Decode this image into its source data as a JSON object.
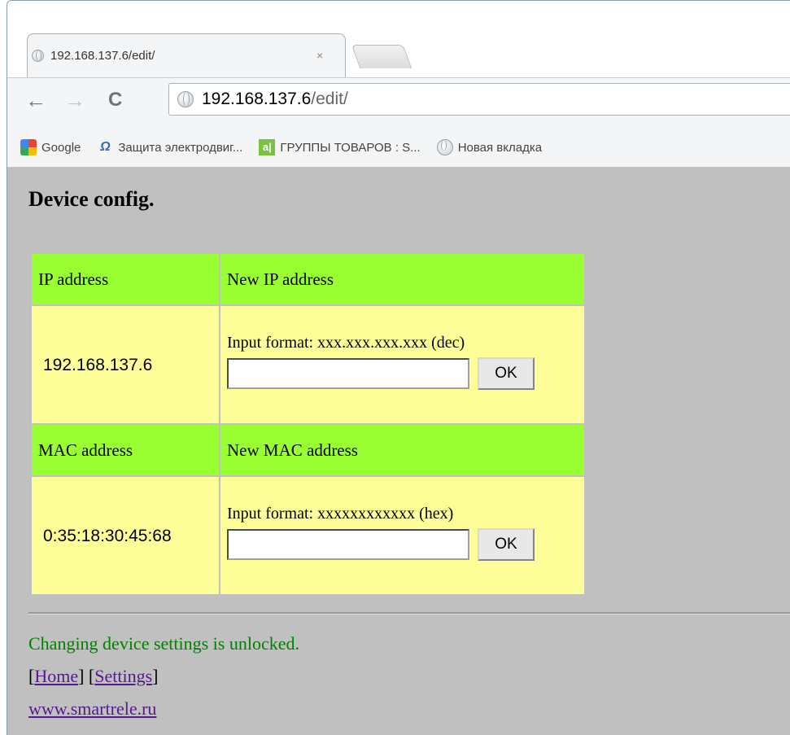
{
  "browser": {
    "tab": {
      "title": "192.168.137.6/edit/",
      "close": "×"
    },
    "nav": {
      "back": "←",
      "forward": "→",
      "reload": "C"
    },
    "address": {
      "host": "192.168.137.6",
      "path": "/edit/"
    },
    "bookmarks": [
      {
        "label": "Google",
        "icon": "google-icon"
      },
      {
        "label": "Защита электродвиг...",
        "icon": "ohm-icon",
        "glyph": "Ω"
      },
      {
        "label": "ГРУППЫ ТОВАРОВ : S...",
        "icon": "groups-icon",
        "glyph": "a|"
      },
      {
        "label": "Новая вкладка",
        "icon": "globe-icon"
      }
    ]
  },
  "page": {
    "title": "Device config.",
    "ip": {
      "header_current": "IP address",
      "header_new": "New IP address",
      "current_value": "192.168.137.6",
      "format": "Input format: xxx.xxx.xxx.xxx (dec)",
      "input_value": "",
      "ok_label": "OK"
    },
    "mac": {
      "header_current": "MAC address",
      "header_new": "New MAC address",
      "current_value": "0:35:18:30:45:68",
      "format": "Input format: xxxxxxxxxxxx (hex)",
      "input_value": "",
      "ok_label": "OK"
    },
    "status": "Changing device settings is unlocked.",
    "links": {
      "open": "[",
      "home": "Home",
      "mid": "] [",
      "settings": "Settings",
      "close": "]"
    },
    "site": "www.smartrele.ru",
    "colors": {
      "header_bg": "#99ff33",
      "value_bg": "#ffff99",
      "page_bg": "#c0c0c0",
      "status": "#008000",
      "link": "#551a8b"
    }
  }
}
